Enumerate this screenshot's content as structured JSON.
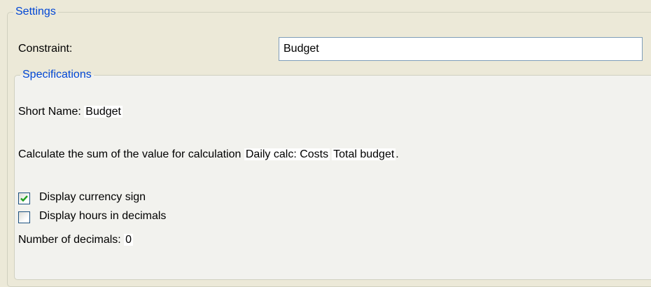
{
  "settings": {
    "legend": "Settings",
    "constraint_label": "Constraint:",
    "constraint_value": "Budget"
  },
  "specifications": {
    "legend": "Specifications",
    "short_name_label": "Short Name:",
    "short_name_value": "Budget",
    "calc_prefix": "Calculate the sum of the value for calculation",
    "calc_part1": "Daily calc: Costs",
    "calc_part2": "Total budget",
    "calc_suffix": ".",
    "options": [
      {
        "label": "Display currency sign",
        "checked": true
      },
      {
        "label": "Display hours in decimals",
        "checked": false
      }
    ],
    "decimals_label": "Number of decimals:",
    "decimals_value": "0"
  },
  "colors": {
    "legend_text": "#0046d5",
    "check_mark": "#21a121",
    "checkbox_border": "#1c5180"
  }
}
